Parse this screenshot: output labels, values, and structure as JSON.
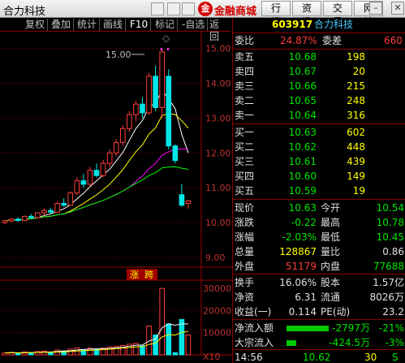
{
  "window": {
    "title": "合力科技",
    "mall_logo": "金",
    "mall": "金融商城",
    "buttons": [
      "行情",
      "资讯",
      "交易",
      "网站"
    ],
    "controls": [
      "▭",
      "–",
      "▢",
      "✕"
    ]
  },
  "toolbar": {
    "items": [
      "复权",
      "叠加",
      "统计",
      "画线",
      "F10",
      "标记",
      "-自选",
      "返回"
    ],
    "active_index": 4
  },
  "chart": {
    "peak_label": "15.00",
    "y_ticks": [
      "15.00",
      "14.00",
      "13.00",
      "12.00",
      "11.00",
      "10.00",
      "9.00"
    ],
    "badge_left": "涨",
    "badge_right": "跨",
    "vol_ticks": [
      "30000",
      "20000",
      "10000"
    ],
    "vol_unit": "X10",
    "colors": {
      "up": "#ff3c3c",
      "down": "#00e6e6",
      "ma5": "#ffffff",
      "ma10": "#ffff00",
      "ma20": "#ff00ff",
      "ma60": "#00ff00"
    }
  },
  "chart_data": {
    "type": "candlestick",
    "ylim": [
      9,
      15.2
    ],
    "candles": [
      {
        "o": 10.0,
        "h": 10.08,
        "l": 9.95,
        "c": 10.05,
        "v": 900
      },
      {
        "o": 10.05,
        "h": 10.12,
        "l": 10.0,
        "c": 10.1,
        "v": 1100
      },
      {
        "o": 10.1,
        "h": 10.15,
        "l": 10.02,
        "c": 10.06,
        "v": 800
      },
      {
        "o": 10.06,
        "h": 10.2,
        "l": 10.04,
        "c": 10.18,
        "v": 1300
      },
      {
        "o": 10.18,
        "h": 10.25,
        "l": 10.1,
        "c": 10.14,
        "v": 1000
      },
      {
        "o": 10.14,
        "h": 10.3,
        "l": 10.12,
        "c": 10.28,
        "v": 1500
      },
      {
        "o": 10.28,
        "h": 10.4,
        "l": 10.2,
        "c": 10.35,
        "v": 1700
      },
      {
        "o": 10.35,
        "h": 10.42,
        "l": 10.25,
        "c": 10.3,
        "v": 1200
      },
      {
        "o": 10.3,
        "h": 10.6,
        "l": 10.28,
        "c": 10.55,
        "v": 2200
      },
      {
        "o": 10.55,
        "h": 10.7,
        "l": 10.45,
        "c": 10.5,
        "v": 1800
      },
      {
        "o": 10.5,
        "h": 10.9,
        "l": 10.48,
        "c": 10.85,
        "v": 2600
      },
      {
        "o": 10.85,
        "h": 11.3,
        "l": 10.8,
        "c": 11.2,
        "v": 3200
      },
      {
        "o": 11.2,
        "h": 11.4,
        "l": 11.0,
        "c": 11.1,
        "v": 2400
      },
      {
        "o": 11.1,
        "h": 11.6,
        "l": 11.05,
        "c": 11.5,
        "v": 3000
      },
      {
        "o": 11.5,
        "h": 11.7,
        "l": 11.3,
        "c": 11.35,
        "v": 2500
      },
      {
        "o": 11.35,
        "h": 11.8,
        "l": 11.3,
        "c": 11.7,
        "v": 3100
      },
      {
        "o": 11.7,
        "h": 12.1,
        "l": 11.6,
        "c": 12.0,
        "v": 3600
      },
      {
        "o": 12.0,
        "h": 12.4,
        "l": 11.9,
        "c": 12.3,
        "v": 3900
      },
      {
        "o": 12.3,
        "h": 12.8,
        "l": 12.2,
        "c": 12.7,
        "v": 4200
      },
      {
        "o": 12.7,
        "h": 13.2,
        "l": 12.6,
        "c": 13.1,
        "v": 4800
      },
      {
        "o": 13.1,
        "h": 13.5,
        "l": 12.9,
        "c": 13.4,
        "v": 5200
      },
      {
        "o": 13.4,
        "h": 13.6,
        "l": 13.0,
        "c": 13.15,
        "v": 4100
      },
      {
        "o": 13.15,
        "h": 14.3,
        "l": 13.1,
        "c": 14.2,
        "v": 13000
      },
      {
        "o": 14.2,
        "h": 14.5,
        "l": 13.2,
        "c": 13.3,
        "v": 9000
      },
      {
        "o": 13.3,
        "h": 15.0,
        "l": 13.0,
        "c": 14.9,
        "v": 30000
      },
      {
        "o": 14.2,
        "h": 14.4,
        "l": 12.1,
        "c": 12.2,
        "v": 14000
      },
      {
        "o": 12.2,
        "h": 12.25,
        "l": 11.7,
        "c": 11.78,
        "v": 1000
      },
      {
        "o": 10.8,
        "h": 11.1,
        "l": 10.45,
        "c": 10.5,
        "v": 16000
      },
      {
        "o": 10.55,
        "h": 10.65,
        "l": 10.4,
        "c": 10.62,
        "v": 9000
      }
    ]
  },
  "quote": {
    "code": "603917",
    "name": "合力科技",
    "weibi_label": "委比",
    "weibi_value": "24.87%",
    "weicha_label": "委差",
    "weicha_value": "660",
    "asks": [
      {
        "label": "卖五",
        "price": "10.68",
        "vol": "198"
      },
      {
        "label": "卖四",
        "price": "10.67",
        "vol": "20"
      },
      {
        "label": "卖三",
        "price": "10.66",
        "vol": "215"
      },
      {
        "label": "卖二",
        "price": "10.65",
        "vol": "248"
      },
      {
        "label": "卖一",
        "price": "10.64",
        "vol": "316"
      }
    ],
    "bids": [
      {
        "label": "买一",
        "price": "10.63",
        "vol": "602"
      },
      {
        "label": "买二",
        "price": "10.62",
        "vol": "448"
      },
      {
        "label": "买三",
        "price": "10.61",
        "vol": "439"
      },
      {
        "label": "买四",
        "price": "10.60",
        "vol": "149"
      },
      {
        "label": "买五",
        "price": "10.59",
        "vol": "19"
      }
    ],
    "stats": [
      {
        "l1": "现价",
        "v1": "10.63",
        "l2": "今开",
        "v2": "10.54",
        "c1": "green",
        "c2": "green"
      },
      {
        "l1": "涨跌",
        "v1": "-0.22",
        "l2": "最高",
        "v2": "10.78",
        "c1": "green",
        "c2": "green"
      },
      {
        "l1": "涨幅",
        "v1": "-2.03%",
        "l2": "最低",
        "v2": "10.45",
        "c1": "green",
        "c2": "green"
      },
      {
        "l1": "总量",
        "v1": "128867",
        "l2": "量比",
        "v2": "0.86",
        "c1": "yellow",
        "c2": "white"
      },
      {
        "l1": "外盘",
        "v1": "51179",
        "l2": "内盘",
        "v2": "77688",
        "c1": "red",
        "c2": "green"
      }
    ],
    "stats2": [
      {
        "l1": "换手",
        "v1": "16.06%",
        "l2": "股本",
        "v2": "1.57亿"
      },
      {
        "l1": "净资",
        "v1": "6.31",
        "l2": "流通",
        "v2": "8026万"
      },
      {
        "l1": "收益(一)",
        "v1": "0.114",
        "l2": "PE(动)",
        "v2": "23.2"
      }
    ],
    "flows": [
      {
        "label": "净流入额",
        "value": "-2797万",
        "pct": "-21%"
      },
      {
        "label": "大宗流入",
        "value": "-424.5万",
        "pct": "-3%"
      }
    ],
    "tick": {
      "time": "14:56",
      "price": "10.62",
      "vol": "30",
      "flag": "S"
    }
  }
}
